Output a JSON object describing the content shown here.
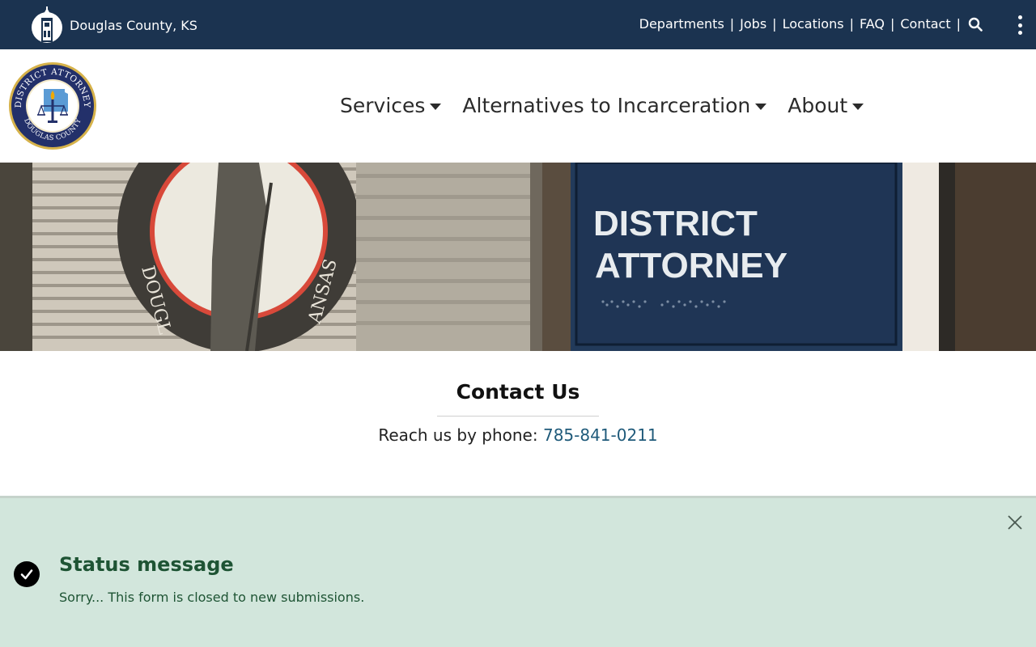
{
  "topbar": {
    "county_name": "Douglas County, KS",
    "county_icon": "courthouse-icon",
    "links": [
      "Departments",
      "Jobs",
      "Locations",
      "FAQ",
      "Contact"
    ],
    "separator": "|",
    "search_icon": "search-icon",
    "menu_icon": "kebab-menu-icon",
    "bg_color": "#1b3350"
  },
  "header": {
    "logo_icon": "district-attorney-seal",
    "seal_text_top": "DISTRICT ATTORNEY",
    "seal_text_bottom": "DOUGLAS COUNTY",
    "nav": [
      "Services",
      "Alternatives to Incarceration",
      "About"
    ]
  },
  "hero": {
    "sign_line1": "DISTRICT",
    "sign_line2": "ATTORNEY",
    "seal_fragment": "DOUGL   ANSAS"
  },
  "contact": {
    "title": "Contact Us",
    "phone_label": "Reach us by phone: ",
    "phone": "785-841-0211",
    "link_color": "#1f5a7a"
  },
  "status": {
    "title": "Status message",
    "message": "Sorry... This form is closed to new submissions.",
    "check_icon": "check-circle-icon",
    "close_icon": "close-icon",
    "bg_color": "#d2e6dc",
    "text_color": "#1e5434"
  }
}
